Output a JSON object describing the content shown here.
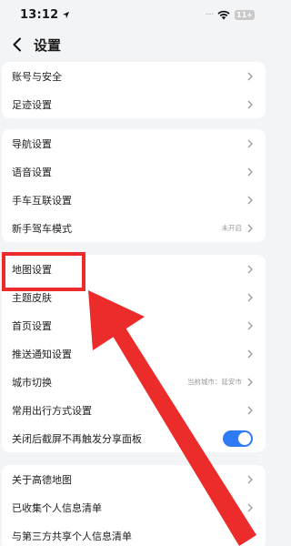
{
  "status_bar": {
    "time": "13:12",
    "signal": "····",
    "battery": "11+"
  },
  "nav": {
    "title": "设置"
  },
  "groups": [
    {
      "items": [
        {
          "label": "账号与安全"
        },
        {
          "label": "足迹设置"
        }
      ]
    },
    {
      "items": [
        {
          "label": "导航设置"
        },
        {
          "label": "语音设置"
        },
        {
          "label": "手车互联设置"
        },
        {
          "label": "新手驾车模式",
          "value": "未开启"
        }
      ]
    },
    {
      "items": [
        {
          "label": "地图设置"
        },
        {
          "label": "主题皮肤"
        },
        {
          "label": "首页设置"
        },
        {
          "label": "推送通知设置"
        },
        {
          "label": "城市切换",
          "value": "当前城市：延安市"
        },
        {
          "label": "常用出行方式设置"
        },
        {
          "label": "关闭后截屏不再触发分享面板",
          "toggle_on": true
        }
      ]
    },
    {
      "items": [
        {
          "label": "关于高德地图"
        },
        {
          "label": "已收集个人信息清单"
        },
        {
          "label": "与第三方共享个人信息清单"
        }
      ]
    }
  ],
  "annotation": {
    "color": "#ec2b2b",
    "target": "地图设置"
  },
  "colors": {
    "toggle_on": "#2f7bf5",
    "background": "#f3f4f6"
  }
}
